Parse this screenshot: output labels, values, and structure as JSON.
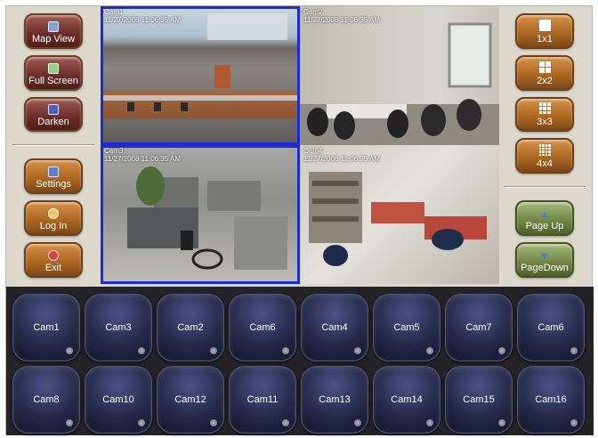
{
  "left_panel": {
    "top_buttons": [
      {
        "label": "Map View",
        "icon": "map-icon"
      },
      {
        "label": "Full Screen",
        "icon": "full-screen-icon"
      },
      {
        "label": "Darken",
        "icon": "darken-icon"
      }
    ],
    "bottom_buttons": [
      {
        "label": "Settings",
        "icon": "settings-icon"
      },
      {
        "label": "Log In",
        "icon": "key-icon"
      },
      {
        "label": "Exit",
        "icon": "exit-icon"
      }
    ]
  },
  "right_panel": {
    "layout_buttons": [
      {
        "label": "1x1",
        "icon": "layout-1x1-icon"
      },
      {
        "label": "2x2",
        "icon": "layout-2x2-icon"
      },
      {
        "label": "3x3",
        "icon": "layout-3x3-icon"
      },
      {
        "label": "4x4",
        "icon": "layout-4x4-icon"
      }
    ],
    "page_buttons": [
      {
        "label": "Page Up",
        "icon": "arrow-up-icon"
      },
      {
        "label": "PageDown",
        "icon": "arrow-down-icon"
      }
    ]
  },
  "viewer": {
    "cells": [
      {
        "camera": "Cam1",
        "timestamp": "11/27/2008 11:06:35 AM",
        "selected": true
      },
      {
        "camera": "Cam2",
        "timestamp": "11/27/2008 11:06:35 AM",
        "selected": false
      },
      {
        "camera": "Cam3",
        "timestamp": "11/27/2008 11:06:35 AM",
        "selected": true
      },
      {
        "camera": "Cam4",
        "timestamp": "11/27/2008 11:06:35 AM",
        "selected": false
      }
    ]
  },
  "camera_tiles": {
    "row1": [
      "Cam1",
      "Cam3",
      "Cam2",
      "Cam6",
      "Cam4",
      "Cam5",
      "Cam7",
      "Cam6"
    ],
    "row2": [
      "Cam8",
      "Cam10",
      "Cam12",
      "Cam11",
      "Cam13",
      "Cam14",
      "Cam15",
      "Cam16"
    ]
  },
  "colors": {
    "selected_border": "#1b2bd6",
    "tile_background": "#262a4a",
    "panel_background": "#dcd8cc"
  }
}
